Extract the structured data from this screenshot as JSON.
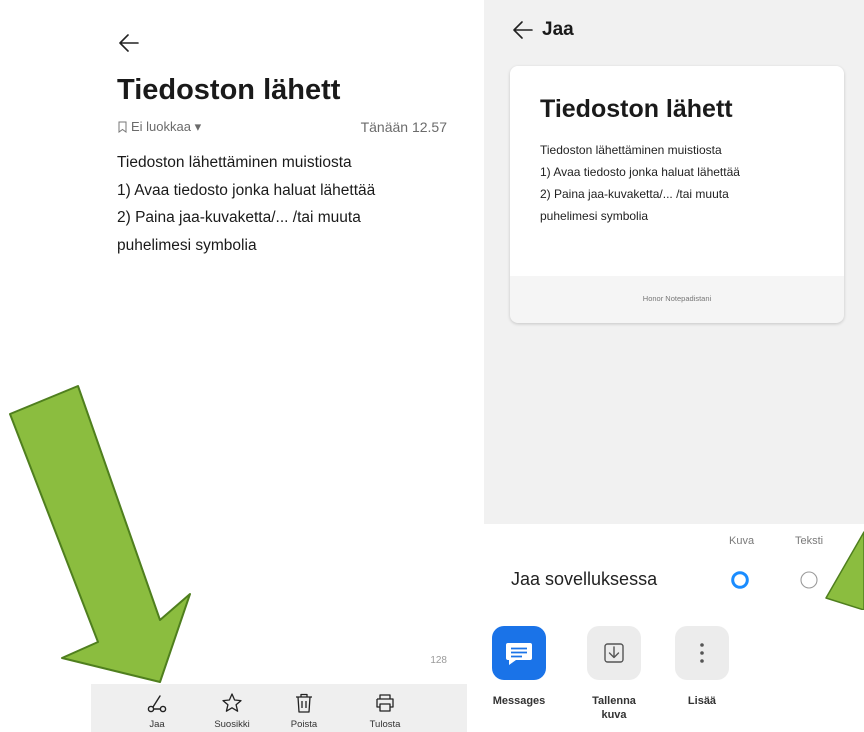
{
  "note_screen": {
    "title": "Tiedoston lähett",
    "category": "Ei luokkaa ▾",
    "timestamp": "Tänään 12.57",
    "body_lines": [
      "Tiedoston lähettäminen muistiosta",
      "1) Avaa tiedosto jonka haluat lähettää",
      "2) Paina jaa-kuvaketta/... /tai muuta",
      "puhelimesi symbolia"
    ],
    "char_count": "128",
    "toolbar": [
      {
        "label": "Jaa",
        "icon": "share-icon"
      },
      {
        "label": "Suosikki",
        "icon": "star-icon"
      },
      {
        "label": "Poista",
        "icon": "trash-icon"
      },
      {
        "label": "Tulosta",
        "icon": "printer-icon"
      }
    ]
  },
  "share_screen": {
    "title": "Jaa",
    "preview": {
      "title": "Tiedoston lähett",
      "body_lines": [
        "Tiedoston lähettäminen muistiosta",
        "1) Avaa tiedosto jonka haluat lähettää",
        "2) Paina jaa-kuvaketta/... /tai muuta",
        "puhelimesi symbolia"
      ],
      "footer": "Honor Notepadistani"
    },
    "format_options": {
      "kuva": "Kuva",
      "teksti": "Teksti",
      "selected": "Kuva"
    },
    "apps_label": "Jaa sovelluksessa",
    "apps": [
      {
        "label_line1": "Messages",
        "label_line2": "",
        "icon": "messages-icon"
      },
      {
        "label_line1": "Tallenna",
        "label_line2": "kuva",
        "icon": "save-image-icon"
      },
      {
        "label_line1": "Lisää",
        "label_line2": "",
        "icon": "more-icon"
      }
    ]
  },
  "colors": {
    "arrow_green": "#8bbd3f",
    "arrow_outline": "#4f7f1e",
    "radio_selected": "#1a8cff",
    "messages_blue": "#1a73e8"
  }
}
